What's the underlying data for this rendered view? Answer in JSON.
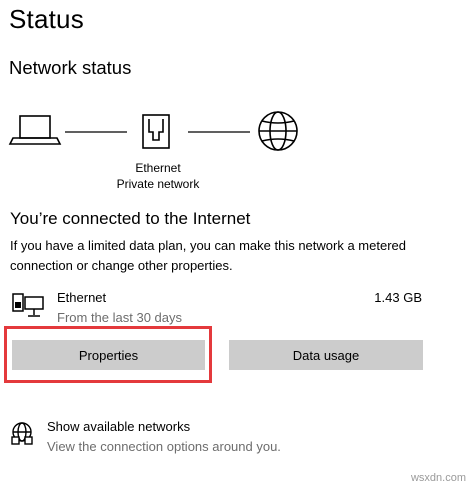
{
  "page": {
    "title": "Status"
  },
  "network_status": {
    "heading": "Network status",
    "adapter_name": "Ethernet",
    "network_profile": "Private network"
  },
  "connection": {
    "heading": "You’re connected to the Internet",
    "description": "If you have a limited data plan, you can make this network a metered connection or change other properties."
  },
  "ethernet": {
    "name": "Ethernet",
    "period": "From the last 30 days",
    "usage": "1.43 GB"
  },
  "buttons": {
    "properties": "Properties",
    "data_usage": "Data usage"
  },
  "available_networks": {
    "title": "Show available networks",
    "subtitle": "View the connection options around you."
  },
  "watermark": "wsxdn.com",
  "colors": {
    "button_bg": "#cccccc",
    "highlight": "#e4393c",
    "secondary_text": "#6d6d6d"
  },
  "icons": [
    "laptop-icon",
    "ethernet-icon",
    "globe-icon",
    "ethernet-pc-icon",
    "wireless-globe-icon"
  ]
}
